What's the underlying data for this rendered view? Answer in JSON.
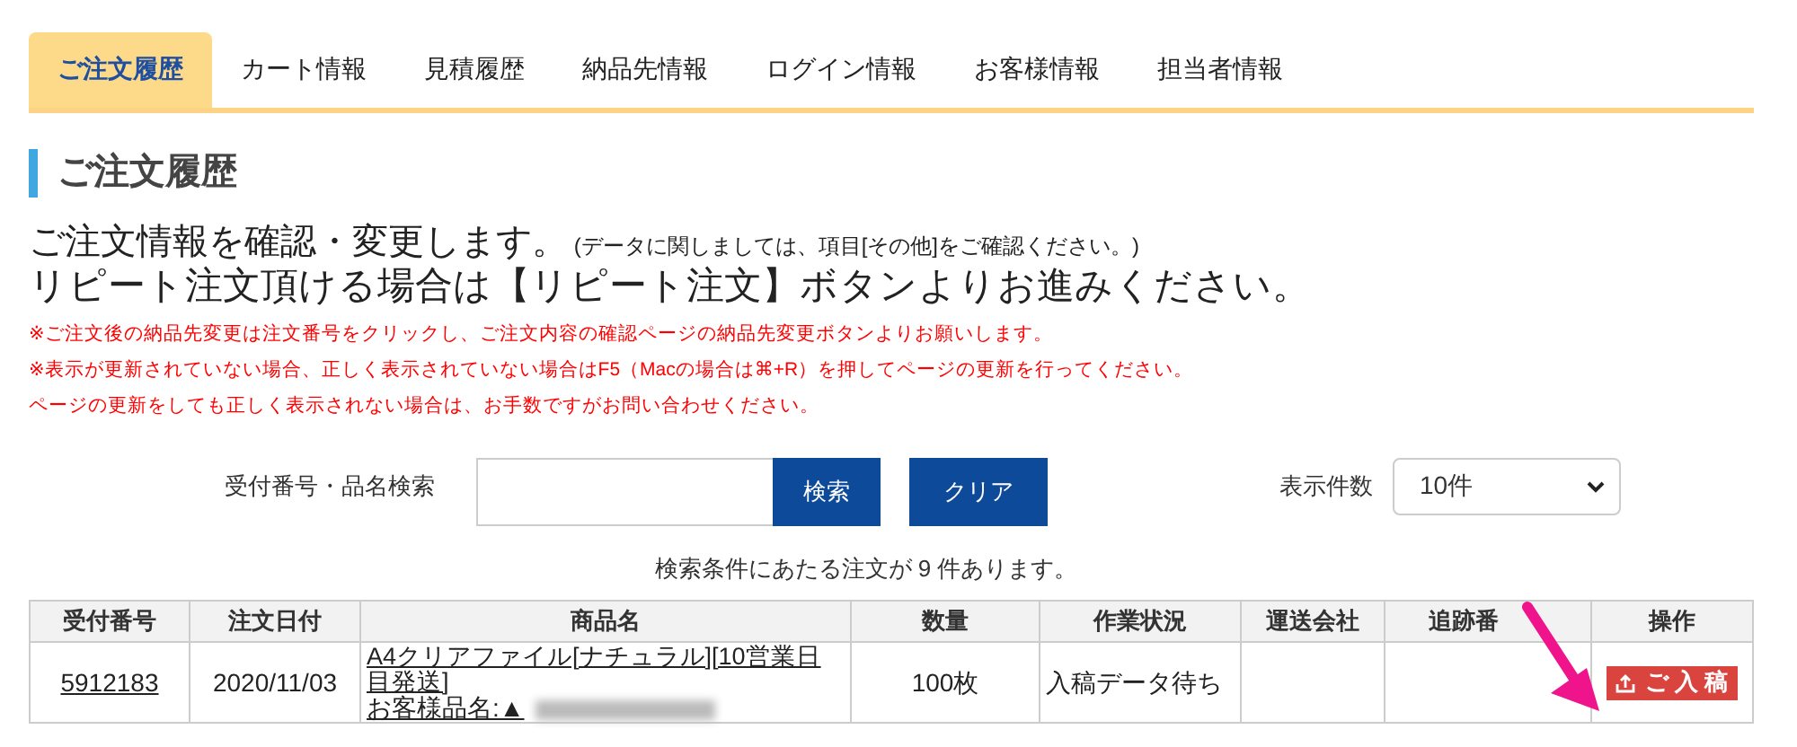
{
  "tabs": [
    {
      "label": "ご注文履歴",
      "selected": true
    },
    {
      "label": "カート情報",
      "selected": false
    },
    {
      "label": "見積履歴",
      "selected": false
    },
    {
      "label": "納品先情報",
      "selected": false
    },
    {
      "label": "ログイン情報",
      "selected": false
    },
    {
      "label": "お客様情報",
      "selected": false
    },
    {
      "label": "担当者情報",
      "selected": false
    }
  ],
  "heading": "ご注文履歴",
  "intro": {
    "line1": "ご注文情報を確認・変更します。",
    "note": "(データに関しましては、項目[その他]をご確認ください。)",
    "line2": "リピート注文頂ける場合は【リピート注文】ボタンよりお進みください。"
  },
  "notices": [
    "※ご注文後の納品先変更は注文番号をクリックし、ご注文内容の確認ページの納品先変更ボタンよりお願いします。",
    "※表示が更新されていない場合、正しく表示されていない場合はF5（Macの場合は⌘+R）を押してページの更新を行ってください。",
    "ページの更新をしても正しく表示されない場合は、お手数ですがお問い合わせください。"
  ],
  "search": {
    "label": "受付番号・品名検索",
    "search_button": "検索",
    "clear_button": "クリア",
    "per_page_label": "表示件数",
    "per_page_value": "10件"
  },
  "result_count": "検索条件にあたる注文が 9 件あります。",
  "table": {
    "columns": [
      "受付番号",
      "注文日付",
      "商品名",
      "数量",
      "作業状況",
      "運送会社",
      "追跡番",
      "操作"
    ],
    "rows": [
      {
        "order_no": "5912183",
        "date": "2020/11/03",
        "product": "A4クリアファイル[ナチュラル][10営業日目発送]",
        "customer_label": "お客様品名:▲",
        "quantity": "100枚",
        "status": "入稿データ待ち",
        "action": "ご 入 稿"
      }
    ]
  }
}
